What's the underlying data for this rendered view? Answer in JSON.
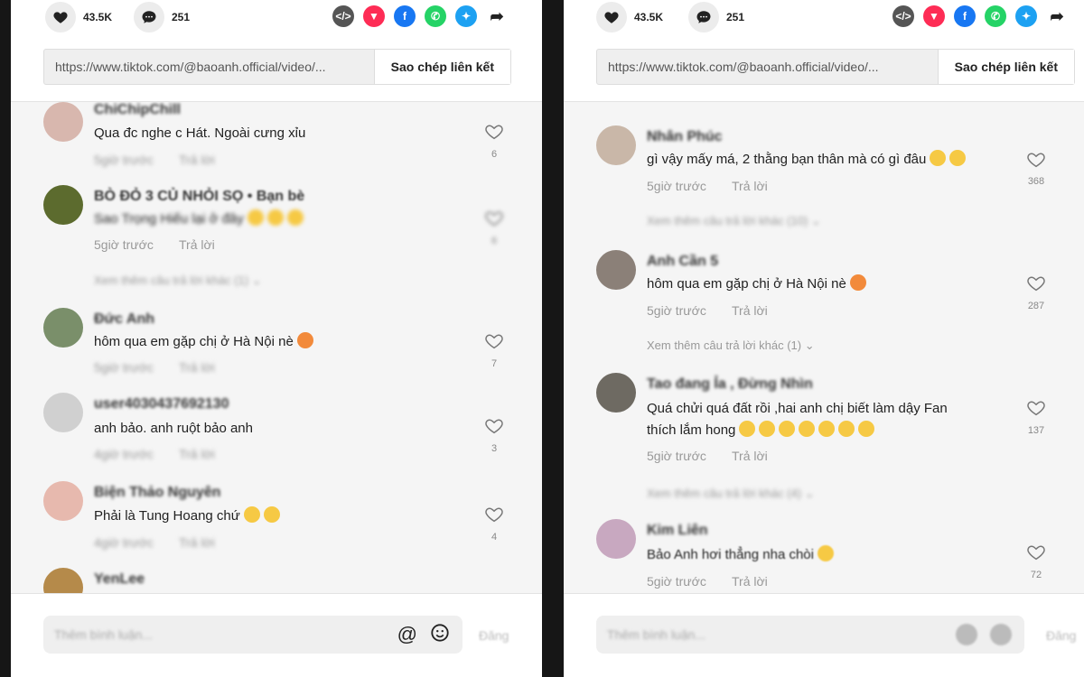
{
  "left": {
    "likes_count": "43.5K",
    "comments_count": "251",
    "url": "https://www.tiktok.com/@baoanh.official/video/...",
    "copy_label": "Sao chép liên kết",
    "comments": [
      {
        "name": "ChiChipChill",
        "text": "Qua đc nghe c Hát. Ngoài cưng xỉu",
        "time": "5giờ trước",
        "reply": "Trả lời",
        "likes": "6",
        "text_blur": false,
        "meta_blur": true
      },
      {
        "name": "BÒ ĐỎ 3 CỦ NHỎI SỌ • Bạn bè",
        "text": "Sao Trọng Hiếu lại ở đây",
        "time": "5giờ trước",
        "reply": "Trả lời",
        "likes": "6",
        "text_blur": true,
        "meta_blur": false
      },
      {
        "name": "Đức Anh",
        "text": "hôm qua em gặp chị ở Hà Nội nè",
        "time": "5giờ trước",
        "reply": "Trả lời",
        "likes": "7",
        "text_blur": false,
        "meta_blur": true
      },
      {
        "name": "user4030437692130",
        "text": "anh bảo. anh ruột bảo anh",
        "time": "4giờ trước",
        "reply": "Trả lời",
        "likes": "3",
        "text_blur": false,
        "meta_blur": true
      },
      {
        "name": "Biện Thảo Nguyên",
        "text": "Phải là Tung Hoang chứ",
        "time": "4giờ trước",
        "reply": "Trả lời",
        "likes": "4",
        "text_blur": false,
        "meta_blur": true
      },
      {
        "name": "YenLee",
        "text": "",
        "time": "",
        "reply": "",
        "likes": "",
        "text_blur": false,
        "meta_blur": true
      }
    ],
    "more_replies": "Xem thêm câu trả lời khác (1)",
    "input_placeholder": "Thêm bình luận...",
    "post_label": "Đăng"
  },
  "right": {
    "likes_count": "43.5K",
    "comments_count": "251",
    "url": "https://www.tiktok.com/@baoanh.official/video/...",
    "copy_label": "Sao chép liên kết",
    "comments": [
      {
        "name": "Nhân Phúc",
        "text": "gì vậy mấy má, 2 thằng bạn thân mà có gì đâu",
        "time": "5giờ trước",
        "reply": "Trả lời",
        "likes": "368"
      },
      {
        "name": "Anh Cần 5",
        "text": "hôm qua em gặp chị ở Hà Nội nè",
        "time": "5giờ trước",
        "reply": "Trả lời",
        "likes": "287"
      },
      {
        "name": "Tao đang Ỉa , Đừng Nhìn",
        "text": "Quá chửi quá đất rồi ,hai anh chị biết làm dậy Fan",
        "text2": "thích lắm hong",
        "time": "5giờ trước",
        "reply": "Trả lời",
        "likes": "137"
      },
      {
        "name": "Kim Liên",
        "text": "Bảo Anh hơi thẳng nha chòi",
        "time": "5giờ trước",
        "reply": "Trả lời",
        "likes": "72"
      }
    ],
    "more_replies_1": "Xem thêm câu trả lời khác (10)",
    "more_replies_2": "Xem thêm câu trả lời khác (1)",
    "more_replies_3": "Xem thêm câu trả lời khác (4)",
    "input_placeholder": "Thêm bình luận...",
    "post_label": "Đăng"
  },
  "icons": {
    "heart": "heart-icon",
    "comment": "comment-icon",
    "embed": "embed-icon",
    "send": "send-icon",
    "facebook": "facebook-icon",
    "whatsapp": "whatsapp-icon",
    "twitter": "twitter-icon",
    "share": "share-arrow-icon",
    "mention": "at-icon",
    "emoji": "emoji-icon"
  },
  "colors": {
    "embed": "#555555",
    "send": "#fe2c55",
    "facebook": "#1877f2",
    "whatsapp": "#25d366",
    "twitter": "#1da1f2"
  }
}
